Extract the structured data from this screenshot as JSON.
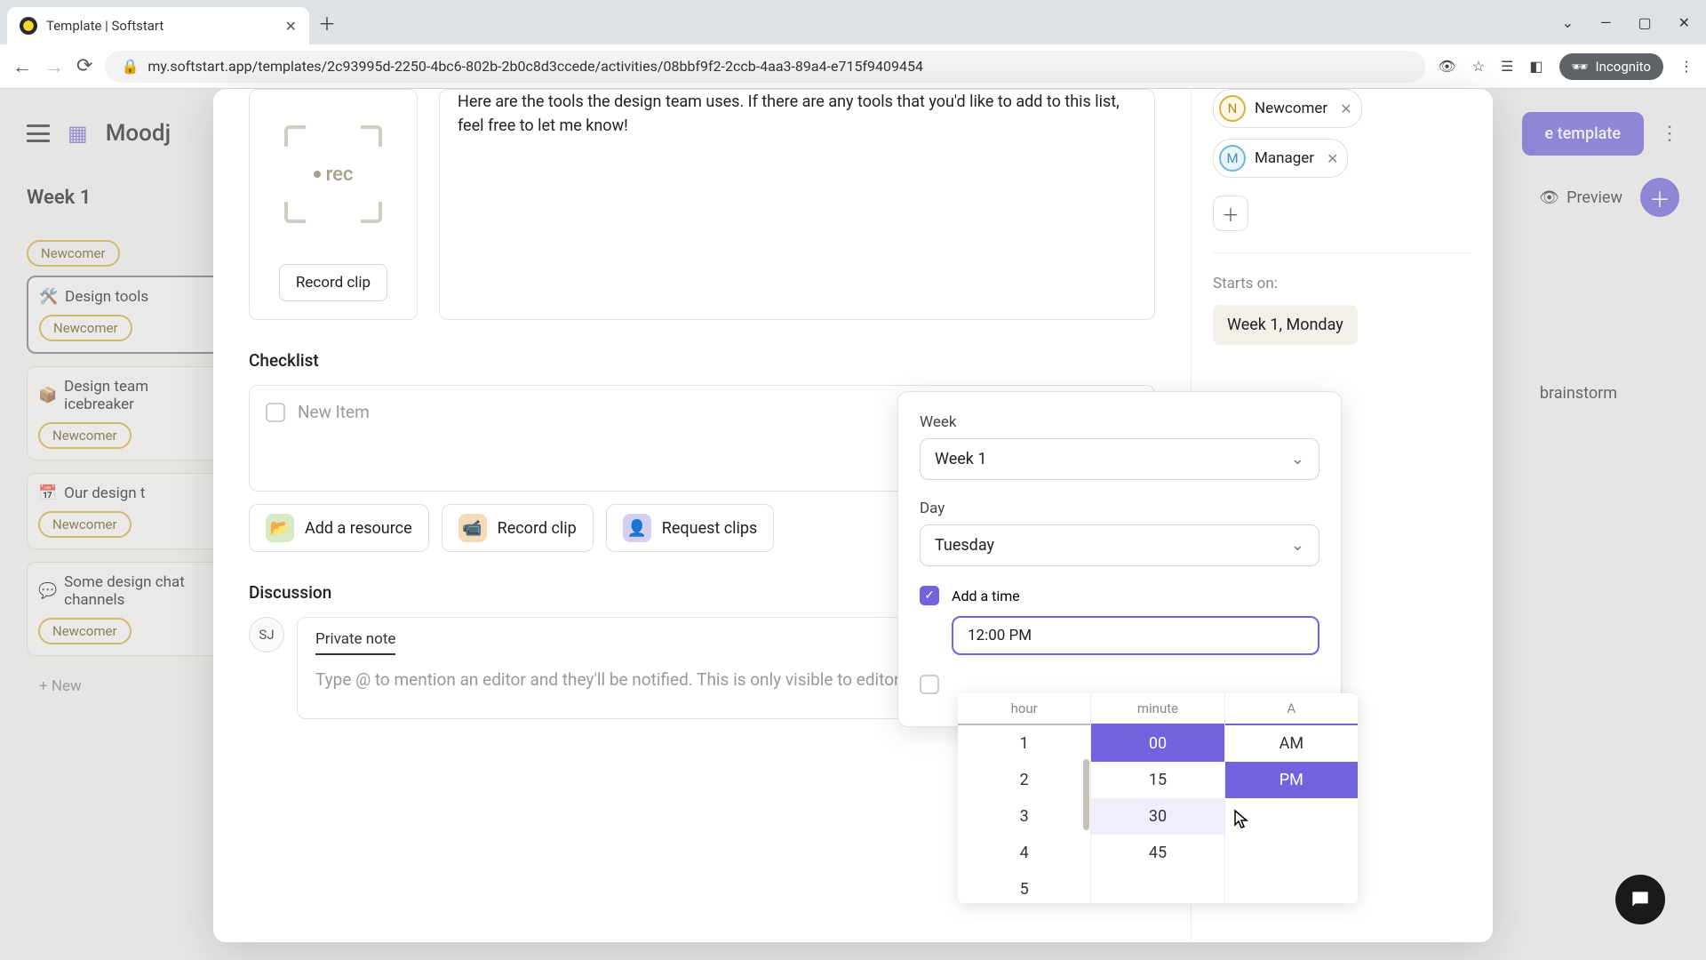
{
  "browser": {
    "tab_title": "Template | Softstart",
    "url": "my.softstart.app/templates/2c93995d-2250-4bc6-802b-2b0c8d3ccede/activities/08bbf9f2-2ccb-4aa3-89a4-e715f9409454",
    "incognito": "Incognito"
  },
  "app": {
    "title": "Moodj",
    "week_label": "Week 1",
    "preview": "Preview",
    "template_btn": "e template",
    "brainstorm_peek": "brainstorm"
  },
  "sidebar_cards": [
    {
      "icon": "🛠️",
      "title": "Design tools",
      "tags": [
        "Newcomer"
      ],
      "active": true,
      "prev_tag": "Newcomer"
    },
    {
      "icon": "📦",
      "title": "Design team icebreaker",
      "tags": [
        "Newcomer"
      ]
    },
    {
      "icon": "📅",
      "title": "Our design t",
      "tags": [
        "Newcomer"
      ]
    },
    {
      "icon": "💬",
      "title": "Some design chat channels",
      "tags": [
        "Newcomer"
      ]
    }
  ],
  "new_card": "+  New",
  "modal": {
    "rec_text": "rec",
    "record_clip": "Record clip",
    "description": "Here are the tools the design team uses. If there are any tools that you'd like to add to this list, feel free to let me know!",
    "checklist_label": "Checklist",
    "new_item": "New Item",
    "chips": {
      "resource": "Add a resource",
      "record": "Record clip",
      "request": "Request clips"
    },
    "discussion_label": "Discussion",
    "avatar": "SJ",
    "note_tab": "Private note",
    "note_placeholder": "Type @ to mention an editor and they'll be notified. This is only visible to editors."
  },
  "side_panel": {
    "roles": [
      {
        "letter": "N",
        "name": "Newcomer",
        "class": "n"
      },
      {
        "letter": "M",
        "name": "Manager",
        "class": "m"
      }
    ],
    "starts_label": "Starts on:",
    "starts_value": "Week 1, Monday"
  },
  "date_popup": {
    "week_label": "Week",
    "week_value": "Week 1",
    "day_label": "Day",
    "day_value": "Tuesday",
    "add_time": "Add a time",
    "time_value": "12:00 PM"
  },
  "time_picker": {
    "headers": {
      "hour": "hour",
      "minute": "minute",
      "ampm": "A"
    },
    "hours": [
      "1",
      "2",
      "3",
      "4",
      "5"
    ],
    "minutes": [
      "00",
      "15",
      "30",
      "45"
    ],
    "ampm": [
      "AM",
      "PM"
    ],
    "selected_minute": "00",
    "hover_minute": "30",
    "selected_ampm": "PM"
  }
}
